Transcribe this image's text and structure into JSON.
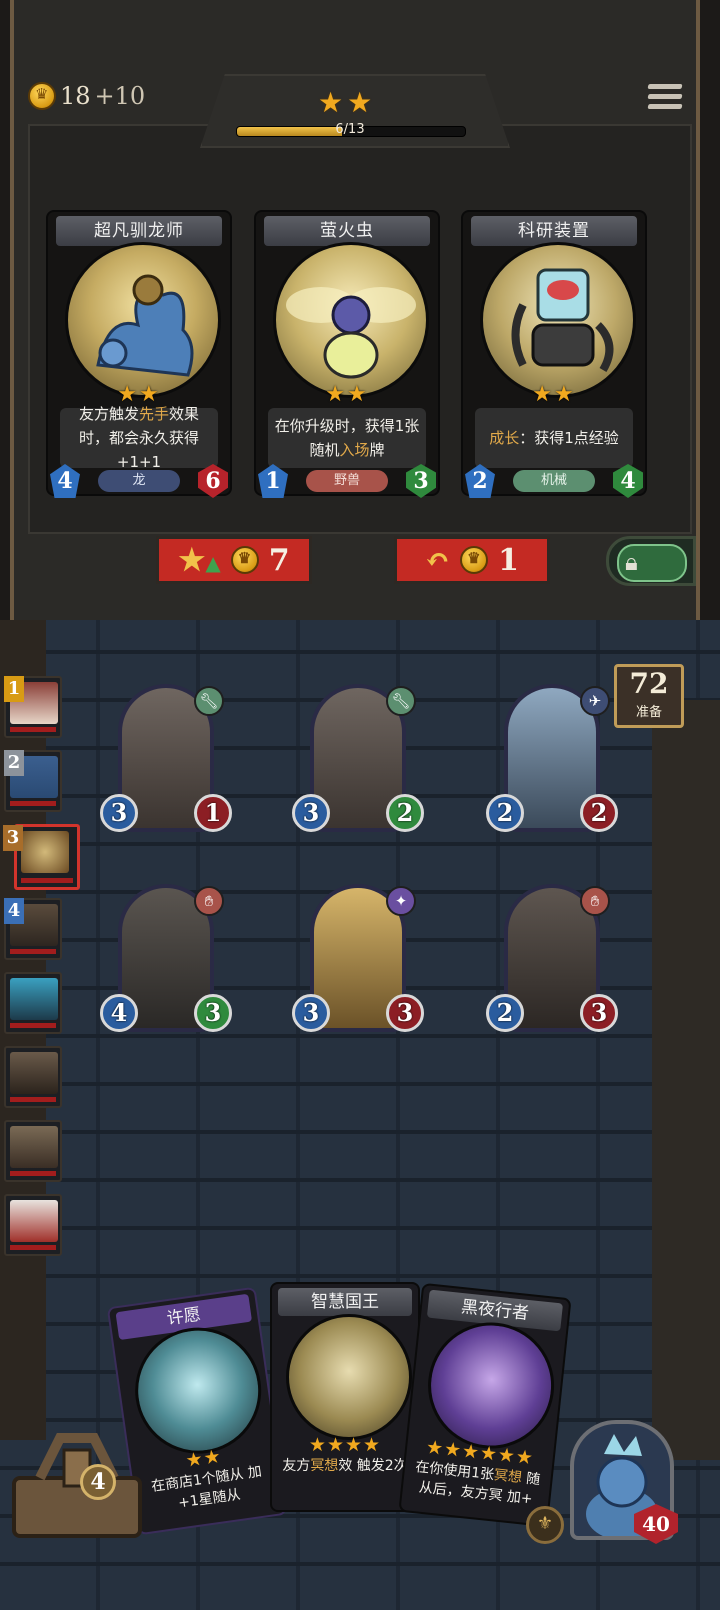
{
  "colors": {
    "gold_star": "#f1a91f",
    "attack_blue": "#2f6fc0",
    "health_red": "#b7232b",
    "shop_button_red": "#c42a23",
    "lock_green": "#2f6b3d"
  },
  "header": {
    "gold": "18",
    "gold_income": "+10",
    "tavern_stars": "★★",
    "xp_progress": 0.46,
    "xp_text": "6/13",
    "menu_icon": "hamburger-menu-icon"
  },
  "shop": {
    "cards": [
      {
        "name": "超凡驯龙师",
        "stars": "★★",
        "desc_before": "友方触发",
        "desc_highlight": "先手",
        "desc_after": "效果时，都会永久获得+1+1",
        "tribe": "龙",
        "tribe_color": "#3e4d74",
        "attack": "4",
        "health": "6"
      },
      {
        "name": "萤火虫",
        "stars": "★★",
        "desc_before": "在你升级时，获得1张随机",
        "desc_highlight": "入场",
        "desc_after": "牌",
        "tribe": "野兽",
        "tribe_color": "#a8534a",
        "attack": "1",
        "health": "3"
      },
      {
        "name": "科研装置",
        "stars": "★★",
        "desc_before": "",
        "desc_highlight": "成长",
        "desc_after": "：获得1点经验",
        "tribe": "机械",
        "tribe_color": "#5c8f70",
        "attack": "2",
        "health": "4"
      }
    ],
    "upgrade_button": {
      "cost": "7",
      "icon": "star-upgrade-icon"
    },
    "refresh_button": {
      "cost": "1",
      "icon": "refresh-arrow-icon"
    },
    "lock_button": {
      "icon": "lock-icon"
    }
  },
  "ready_counter": {
    "number": "72",
    "label": "准备"
  },
  "opponents": [
    {
      "rank": "1",
      "icon": "gnome-portrait-icon"
    },
    {
      "rank": "2",
      "icon": "blue-beast-portrait-icon"
    },
    {
      "rank": "3",
      "icon": "mech-portrait-icon",
      "selected": true
    },
    {
      "rank": "4",
      "icon": "warrior-portrait-icon"
    },
    {
      "rank": "",
      "icon": "cat-demon-portrait-icon"
    },
    {
      "rank": "",
      "icon": "bearded-man-portrait-icon"
    },
    {
      "rank": "",
      "icon": "raccoon-portrait-icon"
    },
    {
      "rank": "",
      "icon": "white-hair-portrait-icon"
    }
  ],
  "board": {
    "minions": [
      {
        "attack": "3",
        "health": "1",
        "tribe_icon": "wrench-icon",
        "tribe_color": "#5c8f70",
        "health_buffed": false
      },
      {
        "attack": "3",
        "health": "2",
        "tribe_icon": "wrench-icon",
        "tribe_color": "#5c8f70",
        "health_buffed": true
      },
      {
        "attack": "2",
        "health": "2",
        "tribe_icon": "dragon-wing-icon",
        "tribe_color": "#3e4d74",
        "health_buffed": false
      },
      {
        "attack": "4",
        "health": "3",
        "tribe_icon": "claw-icon",
        "tribe_color": "#a8534a",
        "health_buffed": true
      },
      {
        "attack": "3",
        "health": "3",
        "tribe_icon": "sparkle-icon",
        "tribe_color": "#6a4fa0",
        "health_buffed": false
      },
      {
        "attack": "2",
        "health": "3",
        "tribe_icon": "claw-icon",
        "tribe_color": "#a8534a",
        "health_buffed": false
      }
    ]
  },
  "hand": {
    "cards": [
      {
        "name": "许愿",
        "stars": "★★",
        "desc": "在商店1个随从 加+1星随从"
      },
      {
        "name": "智慧国王",
        "stars": "★★★★",
        "desc_before": "友方",
        "desc_highlight": "冥想",
        "desc_after": "效 触发2次"
      },
      {
        "name": "黑夜行者",
        "stars": "★★★★★★",
        "desc_before": "在你使用1张",
        "desc_highlight": "冥想",
        "desc_after": " 随从后，友方冥 加+"
      }
    ]
  },
  "footer": {
    "tool_count": "4",
    "hero_health": "40",
    "hero_power_icon": "hero-power-icon"
  }
}
